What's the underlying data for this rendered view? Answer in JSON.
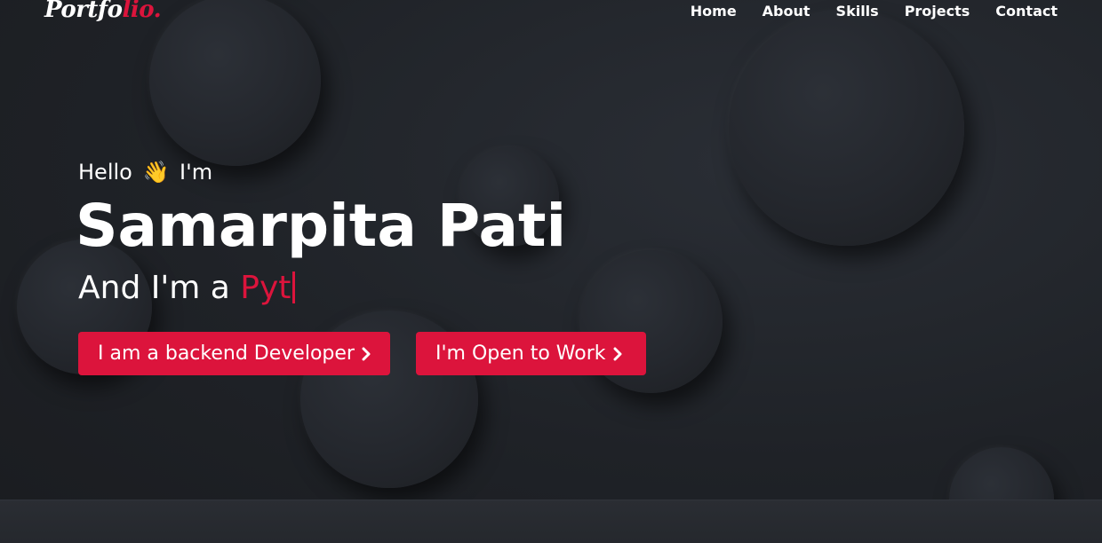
{
  "nav": {
    "logo_main": "Portfo",
    "logo_accent": "lio.",
    "links": [
      "Home",
      "About",
      "Skills",
      "Projects",
      "Contact"
    ]
  },
  "hero": {
    "greeting_before": "Hello",
    "greeting_emoji": "👋",
    "greeting_after": "I'm",
    "name": "Samarpita Pati",
    "role_prefix": "And I'm a",
    "role_typed": "Pyt",
    "buttons": [
      {
        "label": "I am a backend Developer",
        "icon": "chevron-right-icon"
      },
      {
        "label": "I'm Open to Work",
        "icon": "chevron-right-icon"
      }
    ]
  },
  "colors": {
    "accent": "#dc143c",
    "background": "#1f2227",
    "text": "#ffffff"
  }
}
